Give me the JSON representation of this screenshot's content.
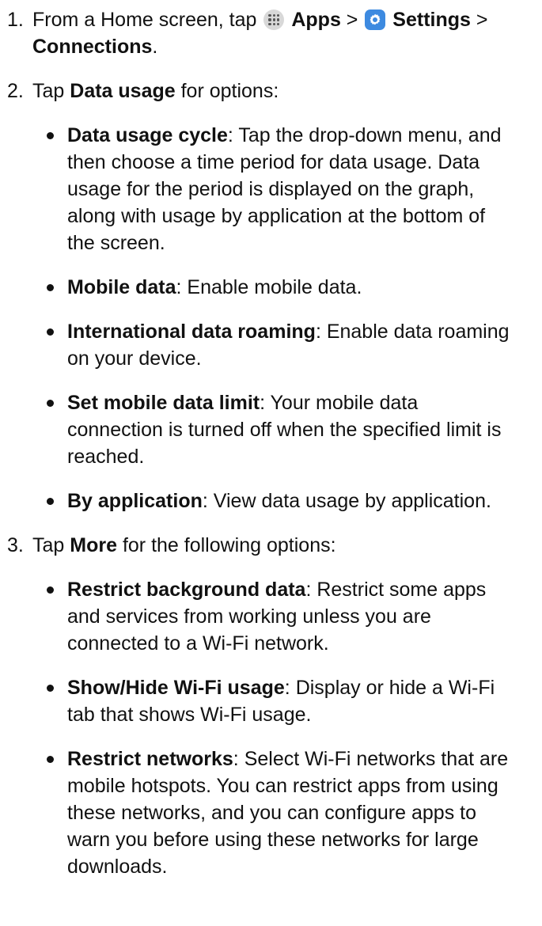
{
  "steps": [
    {
      "number": "1.",
      "parts": {
        "prefix": "From a Home screen, tap ",
        "apps_label": "Apps",
        "sep1": " > ",
        "settings_label": "Settings",
        "sep2": " > ",
        "connections_label": "Connections",
        "suffix": "."
      }
    },
    {
      "number": "2.",
      "prefix": "Tap ",
      "bold": "Data usage",
      "suffix": " for options:",
      "bullets": [
        {
          "term": "Data usage cycle",
          "text": ": Tap the drop-down menu, and then choose a time period for data usage. Data usage for the period is displayed on the graph, along with usage by application at the bottom of the screen."
        },
        {
          "term": "Mobile data",
          "text": ": Enable mobile data."
        },
        {
          "term": "International data roaming",
          "text": ": Enable data roaming on your device."
        },
        {
          "term": "Set mobile data limit",
          "text": ": Your mobile data connection is turned off when the specified limit is reached."
        },
        {
          "term": "By application",
          "text": ": View data usage by application."
        }
      ]
    },
    {
      "number": "3.",
      "prefix": "Tap ",
      "bold": "More",
      "suffix": " for the following options:",
      "bullets": [
        {
          "term": "Restrict background data",
          "text": ": Restrict some apps and services from working unless you are connected to a Wi-Fi network."
        },
        {
          "term": "Show/Hide Wi-Fi usage",
          "text": ": Display or hide a Wi-Fi tab that shows Wi-Fi usage."
        },
        {
          "term": "Restrict networks",
          "text": ": Select Wi-Fi networks that are mobile hotspots. You can restrict apps from using these networks, and you can configure apps to warn you before using these networks for large downloads."
        }
      ]
    }
  ],
  "icons": {
    "apps": "apps-icon",
    "settings": "settings-gear-icon"
  },
  "colors": {
    "settings_icon_bg": "#3d8ae0",
    "apps_icon_bg": "#d8d8d8"
  }
}
